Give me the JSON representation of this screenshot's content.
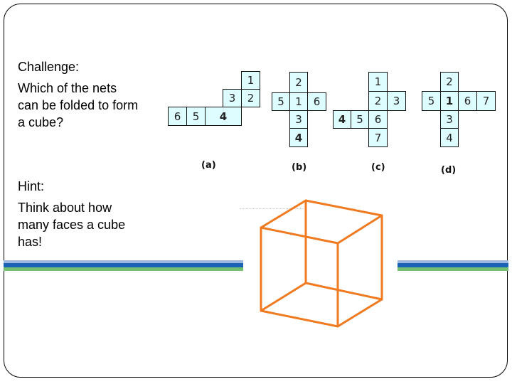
{
  "challenge": {
    "title": "Challenge:",
    "lines": [
      "Which of the nets",
      "can be folded to form",
      "a cube?"
    ]
  },
  "hint": {
    "title": "Hint:",
    "lines": [
      "Think about how",
      "many faces a cube",
      "has!"
    ]
  },
  "nets": [
    {
      "label": "(a)",
      "cells": [
        "1",
        "3",
        "2",
        "6",
        "5",
        "4"
      ]
    },
    {
      "label": "(b)",
      "cells": [
        "2",
        "5",
        "1",
        "6",
        "3",
        "4"
      ]
    },
    {
      "label": "(c)",
      "cells": [
        "1",
        "2",
        "3",
        "4",
        "5",
        "6",
        "7"
      ]
    },
    {
      "label": "(d)",
      "cells": [
        "2",
        "5",
        "1",
        "6",
        "7",
        "3",
        "4"
      ]
    }
  ],
  "colors": {
    "cube_stroke": "#f07a20",
    "cell_fill": "#ddfdff",
    "stripe_light_blue": "#9fb8e0",
    "stripe_blue": "#1a63b8",
    "stripe_green": "#72c070"
  }
}
